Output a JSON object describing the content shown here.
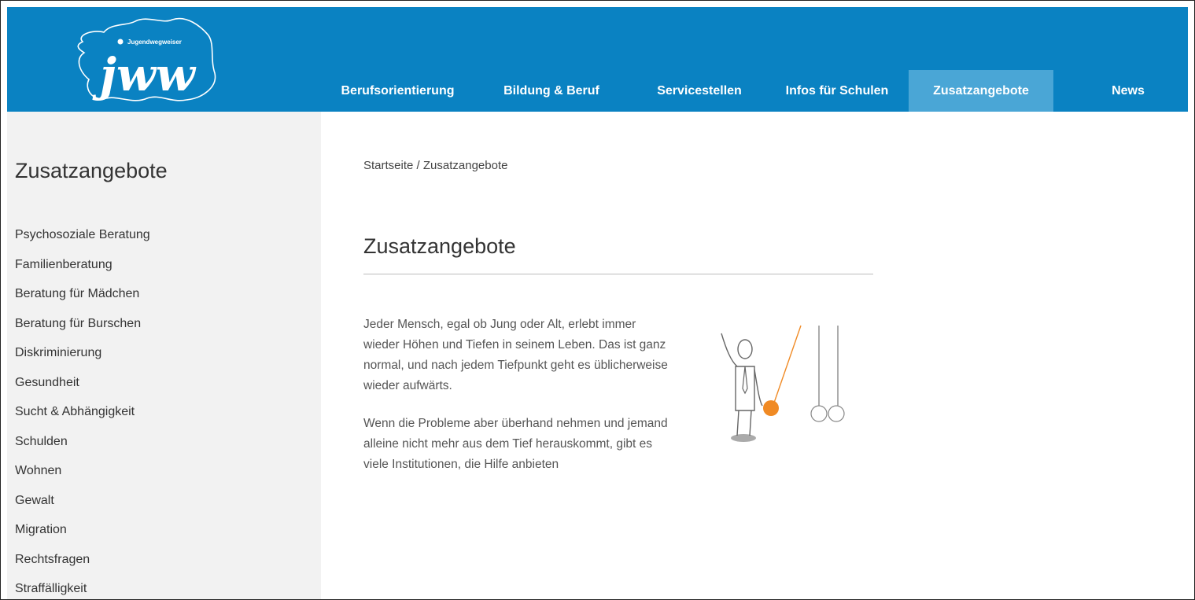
{
  "logo": {
    "text": "Jugendwegweiser",
    "monogram": "jww"
  },
  "nav": [
    {
      "label": "Berufsorientierung",
      "active": false
    },
    {
      "label": "Bildung & Beruf",
      "active": false
    },
    {
      "label": "Servicestellen",
      "active": false
    },
    {
      "label": "Infos für Schulen",
      "active": false
    },
    {
      "label": "Zusatzangebote",
      "active": true
    },
    {
      "label": "News",
      "active": false
    }
  ],
  "sidebar": {
    "title": "Zusatzangebote",
    "items": [
      "Psychosoziale Beratung",
      "Familienberatung",
      "Beratung für Mädchen",
      "Beratung für Burschen",
      "Diskriminierung",
      "Gesundheit",
      "Sucht & Abhängigkeit",
      "Schulden",
      "Wohnen",
      "Gewalt",
      "Migration",
      "Rechtsfragen",
      "Straffälligkeit"
    ]
  },
  "breadcrumb": {
    "home": "Startseite",
    "separator": " / ",
    "current": "Zusatzangebote"
  },
  "main": {
    "title": "Zusatzangebote",
    "paragraph1": "Jeder Mensch, egal ob Jung oder Alt, erlebt immer wieder Höhen und Tiefen in seinem Leben. Das ist ganz normal, und nach jedem Tiefpunkt geht es üblicherweise wieder aufwärts.",
    "paragraph2": "Wenn die Probleme aber überhand nehmen und jemand alleine nicht mehr aus dem Tief herauskommt, gibt es viele Institutionen, die Hilfe anbieten"
  },
  "colors": {
    "header": "#0a82c2",
    "nav_active": "#4aa6d6",
    "sidebar": "#f2f2f2",
    "accent": "#f08a24"
  }
}
